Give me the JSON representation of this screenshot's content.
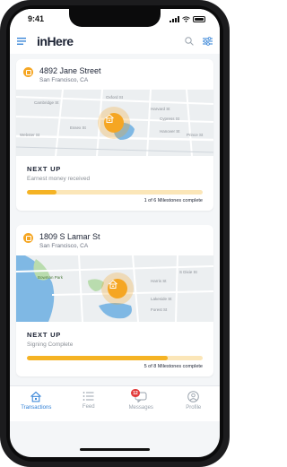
{
  "status_bar": {
    "time": "9:41"
  },
  "header": {
    "logo": "inHere",
    "menu_icon": "menu-icon",
    "search_icon": "search-icon",
    "filter_icon": "filter-icon"
  },
  "transactions": [
    {
      "address": "4892 Jane Street",
      "city": "San Francisco, CA",
      "next_up_label": "NEXT UP",
      "next_up_item": "Earnest money received",
      "progress": {
        "completed": 1,
        "total": 6,
        "fraction": 0.167
      },
      "progress_text": "1 of 6 Milestones complete",
      "map_labels": [
        "Cambridge St",
        "Oxford St",
        "Harvard St",
        "Cypress St",
        "Essex St",
        "Hanover St",
        "Webster St",
        "Prince St"
      ]
    },
    {
      "address": "1809 S Lamar St",
      "city": "San Francisco, CA",
      "next_up_label": "NEXT UP",
      "next_up_item": "Signing Complete",
      "progress": {
        "completed": 5,
        "total": 8,
        "fraction": 0.8
      },
      "progress_text": "5 of 8 Milestones complete",
      "map_labels": [
        "Bowman Park",
        "S Dixie St",
        "Harris St",
        "Lakeside St",
        "Forest St"
      ]
    }
  ],
  "tabs": [
    {
      "label": "Transactions",
      "icon": "house-icon",
      "active": true
    },
    {
      "label": "Feed",
      "icon": "list-icon",
      "active": false
    },
    {
      "label": "Messages",
      "icon": "chat-icon",
      "active": false,
      "badge": "12"
    },
    {
      "label": "Profile",
      "icon": "person-icon",
      "active": false
    }
  ],
  "colors": {
    "accent": "#f5a623",
    "active_tab": "#2e7fd6",
    "progress_track": "#fbe6b8",
    "badge": "#e23b3b"
  }
}
